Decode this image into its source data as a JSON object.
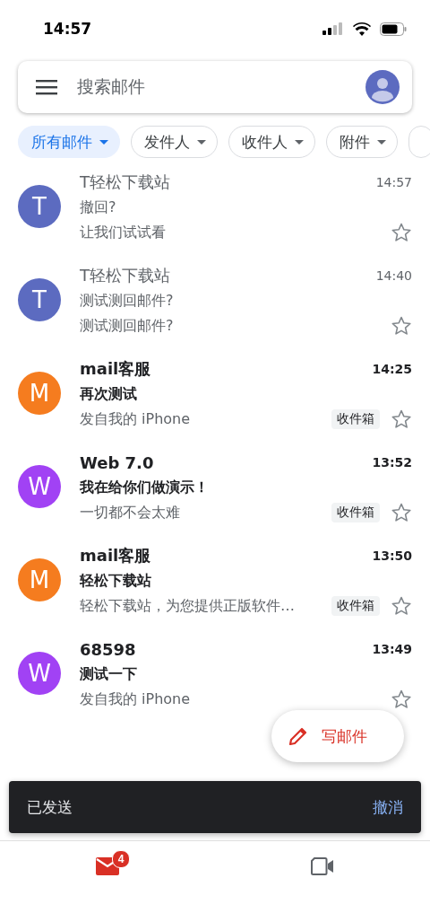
{
  "status_bar": {
    "time": "14:57"
  },
  "search": {
    "placeholder": "搜索邮件"
  },
  "chips": [
    {
      "label": "所有邮件",
      "selected": true
    },
    {
      "label": "发件人",
      "selected": false
    },
    {
      "label": "收件人",
      "selected": false
    },
    {
      "label": "附件",
      "selected": false
    },
    {
      "selected": false
    }
  ],
  "mails": [
    {
      "initial": "T",
      "color": "#5c6bc0",
      "sender": "T轻松下载站",
      "time": "14:57",
      "subject": "撤回?",
      "snippet": "让我们试试看",
      "unread": false,
      "starred": false
    },
    {
      "initial": "T",
      "color": "#5c6bc0",
      "sender": "T轻松下载站",
      "time": "14:40",
      "subject": "测试测回邮件?",
      "snippet": "测试测回邮件?",
      "unread": false,
      "starred": false
    },
    {
      "initial": "M",
      "color": "#f57c1f",
      "sender": "mail客服",
      "time": "14:25",
      "subject": "再次测试",
      "snippet": "发自我的 iPhone",
      "label": "收件箱",
      "unread": true,
      "starred": false
    },
    {
      "initial": "W",
      "color": "#a142f4",
      "sender": "Web 7.0",
      "time": "13:52",
      "subject": "我在给你们做演示！",
      "snippet": "一切都不会太难",
      "label": "收件箱",
      "unread": true,
      "starred": false
    },
    {
      "initial": "M",
      "color": "#f57c1f",
      "sender": "mail客服",
      "time": "13:50",
      "subject": "轻松下载站",
      "snippet": "轻松下载站，为您提供正版软件…",
      "label": "收件箱",
      "unread": true,
      "starred": false
    },
    {
      "initial": "W",
      "color": "#a142f4",
      "sender": "68598",
      "time": "13:49",
      "subject": "测试一下",
      "snippet": "发自我的 iPhone",
      "unread": true,
      "starred": false
    }
  ],
  "compose": {
    "label": "写邮件"
  },
  "snackbar": {
    "message": "已发送",
    "action": "撤消"
  },
  "bottom_nav": [
    {
      "kind": "mail",
      "badge": "4",
      "selected": true
    },
    {
      "kind": "meet",
      "selected": false
    }
  ]
}
